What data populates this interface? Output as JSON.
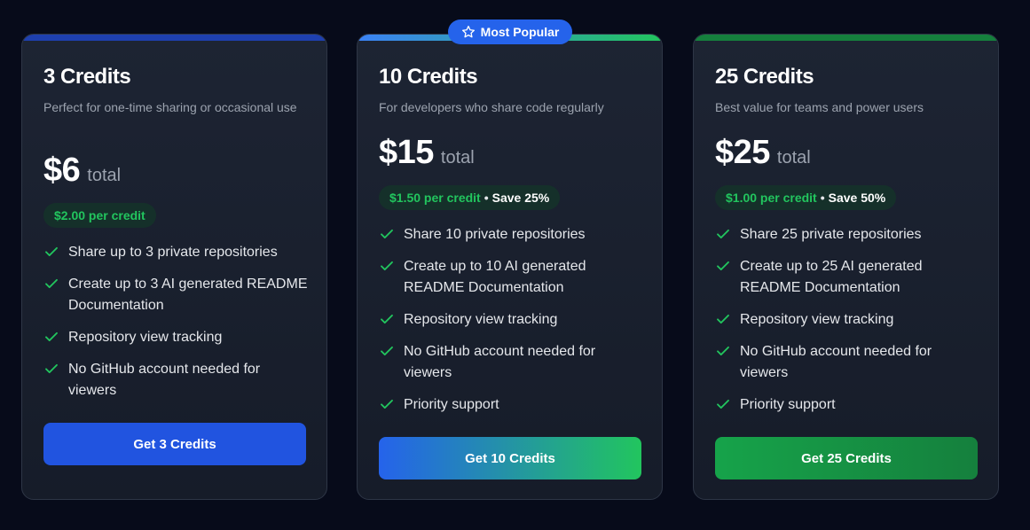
{
  "badge": {
    "label": "Most Popular",
    "icon": "star-icon"
  },
  "colors": {
    "background": "#070b1a",
    "card": "#1a2030",
    "accent_blue": "#2563eb",
    "accent_green": "#22c55e",
    "dark_green": "#15803d"
  },
  "plans": [
    {
      "title": "3 Credits",
      "description": "Perfect for one-time sharing or occasional use",
      "price": "$6",
      "price_suffix": "total",
      "per_credit": "$2.00 per credit",
      "savings": "",
      "features": [
        "Share up to 3 private repositories",
        "Create up to 3 AI generated README Documentation",
        "Repository view tracking",
        "No GitHub account needed for viewers"
      ],
      "cta_label": "Get 3 Credits"
    },
    {
      "title": "10 Credits",
      "description": "For developers who share code regularly",
      "price": "$15",
      "price_suffix": "total",
      "per_credit": "$1.50 per credit",
      "savings_separator": "•",
      "savings": "Save 25%",
      "features": [
        "Share 10 private repositories",
        "Create up to 10 AI generated README Documentation",
        "Repository view tracking",
        "No GitHub account needed for viewers",
        "Priority support"
      ],
      "cta_label": "Get 10 Credits"
    },
    {
      "title": "25 Credits",
      "description": "Best value for teams and power users",
      "price": "$25",
      "price_suffix": "total",
      "per_credit": "$1.00 per credit",
      "savings_separator": "•",
      "savings": "Save 50%",
      "features": [
        "Share 25 private repositories",
        "Create up to 25 AI generated README Documentation",
        "Repository view tracking",
        "No GitHub account needed for viewers",
        "Priority support"
      ],
      "cta_label": "Get 25 Credits"
    }
  ]
}
